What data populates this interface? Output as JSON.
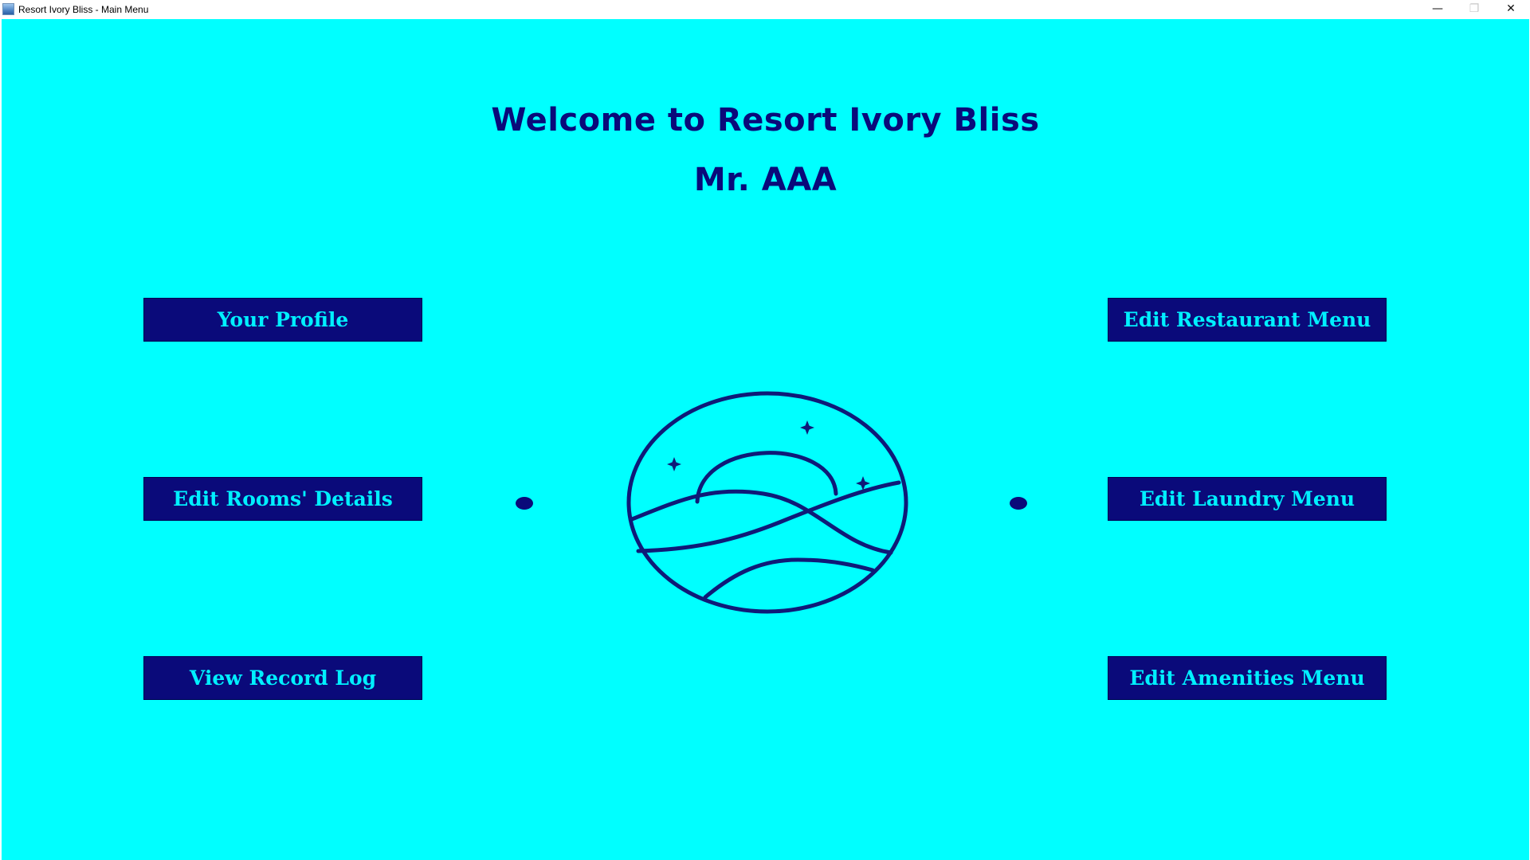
{
  "window": {
    "title": "Resort Ivory Bliss - Main Menu",
    "controls": {
      "minimize": "—",
      "maximize": "❐",
      "close": "✕"
    }
  },
  "header": {
    "welcome": "Welcome to Resort Ivory Bliss",
    "user_name": "Mr. AAA"
  },
  "menu": {
    "your_profile": "Your Profile",
    "edit_rooms": "Edit Rooms' Details",
    "view_record_log": "View Record Log",
    "edit_restaurant": "Edit Restaurant Menu",
    "edit_laundry": "Edit Laundry Menu",
    "edit_amenities": "Edit Amenities Menu"
  },
  "theme": {
    "background": "#00ffff",
    "primary": "#0a0a7a",
    "button_text": "#00f0ff"
  },
  "logo": {
    "icon": "sunset-waves-logo-icon"
  }
}
